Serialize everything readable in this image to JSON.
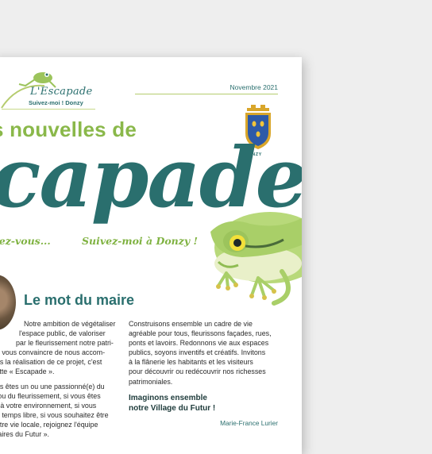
{
  "header": {
    "logo_title": "L'Escapade",
    "logo_subtitle": "Suivez-moi ! Donzy",
    "date": "Novembre 2021",
    "crest_label": "DONZY"
  },
  "masthead": {
    "headline": "s nouvelles de",
    "big_word": "capade",
    "tagline_left": "dez-vous...",
    "tagline_right": "Suivez-moi à Donzy !"
  },
  "section": {
    "title": "Le mot du maire"
  },
  "column_left": {
    "paragraph_1_lines": [
      "Notre ambition de végétaliser",
      "l'espace public, de valoriser",
      "par le fleurissement notre patri-",
      "de vous convaincre de nous accom-",
      "ans la réalisation de ce projet, c'est",
      "cette « Escapade »."
    ],
    "paragraph_2_lines": [
      "ous êtes un ou une passionné(e) du",
      "e ou du fleurissement, si vous êtes",
      "e) à votre environnement, si vous",
      "de temps libre, si vous souhaitez être",
      "notre vie locale, rejoignez l'équipe",
      "ntaires du Futur »."
    ]
  },
  "column_right": {
    "paragraph_lines": [
      "Construisons ensemble un cadre de vie",
      "agréable pour tous, fleurissons façades, rues,",
      "ponts et lavoirs. Redonnons vie aux espaces",
      "publics, soyons inventifs et créatifs. Invitons",
      "à la flânerie les habitants et les visiteurs",
      "pour découvrir ou redécouvrir nos richesses",
      "patrimoniales."
    ],
    "closing_line_1": "Imaginons ensemble",
    "closing_line_2": "notre Village du Futur !",
    "signature": "Marie-France Lurier"
  },
  "colors": {
    "teal": "#2a6f6e",
    "green": "#8ab84a",
    "frog_green": "#b8d97a"
  }
}
